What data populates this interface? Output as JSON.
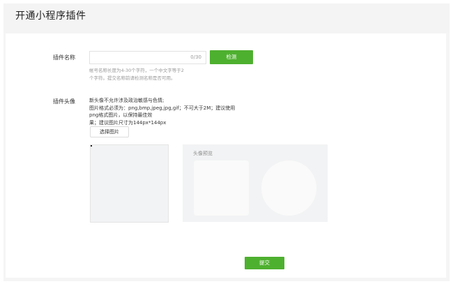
{
  "header": {
    "title": "开通小程序插件"
  },
  "plugin_name": {
    "label": "插件名称",
    "value": "",
    "counter": "0/30",
    "check_button": "检测",
    "hint_line1": "帐号名称长度为4-30个字符，一个中文字等于2",
    "hint_line2": "个字符。提交名称前请检测名称是否可用。"
  },
  "plugin_avatar": {
    "label": "插件头像",
    "note_line1": "新头像不允许涉及政治敏感与色情;",
    "note_line2": "图片格式必须为：png,bmp,jpeg,jpg,gif；不可大于2M；建议使用png格式图片，以保持最佳效",
    "note_line3": "果；建议图片尺寸为144px*144px",
    "choose_button": "选择图片",
    "preview_label": "头像预览"
  },
  "footer": {
    "submit_button": "提交"
  },
  "colors": {
    "accent": "#4eb02f",
    "background": "#f5f5f5"
  }
}
